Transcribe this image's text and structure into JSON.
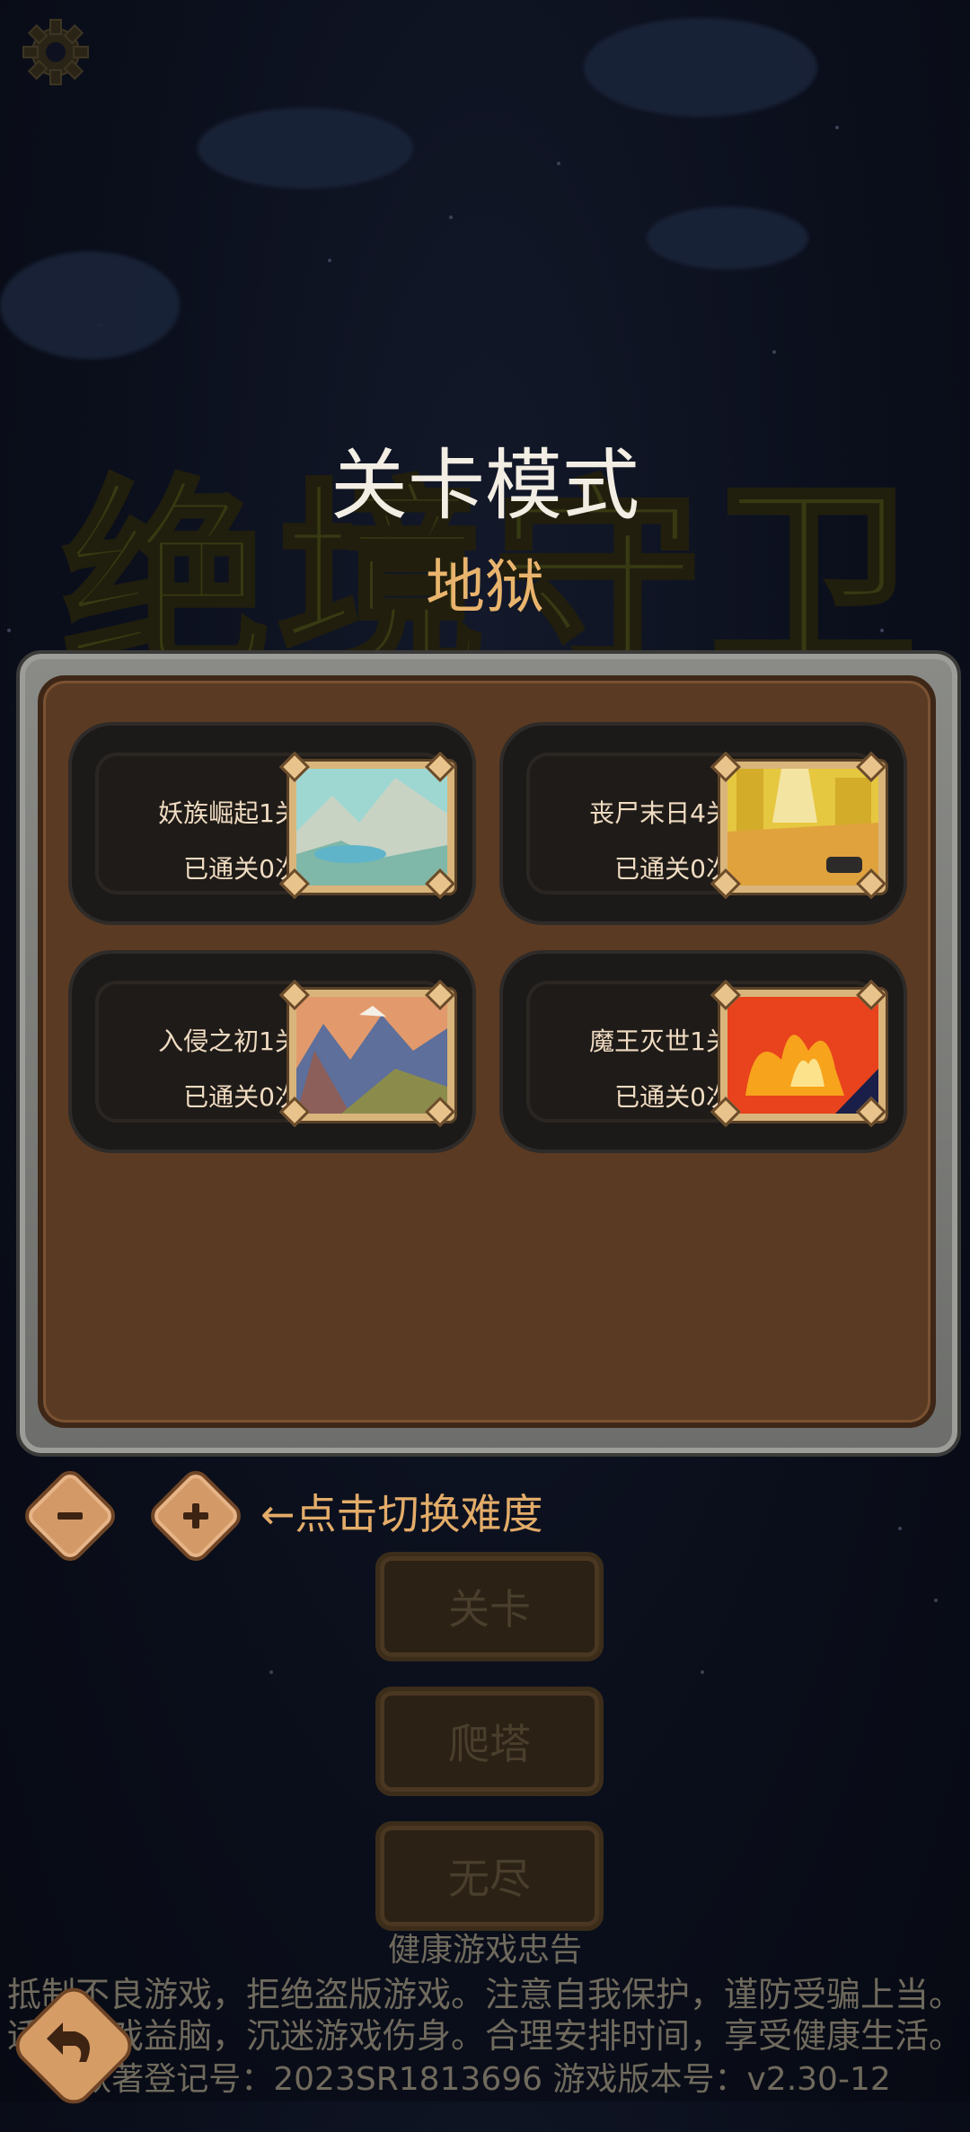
{
  "header": {
    "settings_icon": "gear-icon",
    "logo_text": "绝境守卫",
    "mode_title": "关卡模式",
    "difficulty": "地狱"
  },
  "levels": [
    {
      "name": "妖族崛起1关",
      "cleared": "已通关0次",
      "thumb": "mountain-lake-scene"
    },
    {
      "name": "丧尸末日4关",
      "cleared": "已通关0次",
      "thumb": "desert-road-scene"
    },
    {
      "name": "入侵之初1关",
      "cleared": "已通关0次",
      "thumb": "mountain-sunset-scene"
    },
    {
      "name": "魔王灭世1关",
      "cleared": "已通关0次",
      "thumb": "fire-scene"
    }
  ],
  "difficulty_controls": {
    "minus_icon": "minus-icon",
    "plus_icon": "plus-icon",
    "hint": "←点击切换难度"
  },
  "menu": {
    "level": "关卡",
    "tower": "爬塔",
    "endless": "无尽"
  },
  "footer": {
    "heading": "健康游戏忠告",
    "line1": "抵制不良游戏，拒绝盗版游戏。注意自我保护，谨防受骗上当。",
    "line2": "适度游戏益脑，沉迷游戏伤身。合理安排时间，享受健康生活。",
    "line3": "软著登记号：2023SR1813696   游戏版本号：v2.30-12"
  },
  "back_icon": "back-arrow-icon",
  "colors": {
    "accent": "#e3ac69",
    "panel": "#5a3a22"
  }
}
